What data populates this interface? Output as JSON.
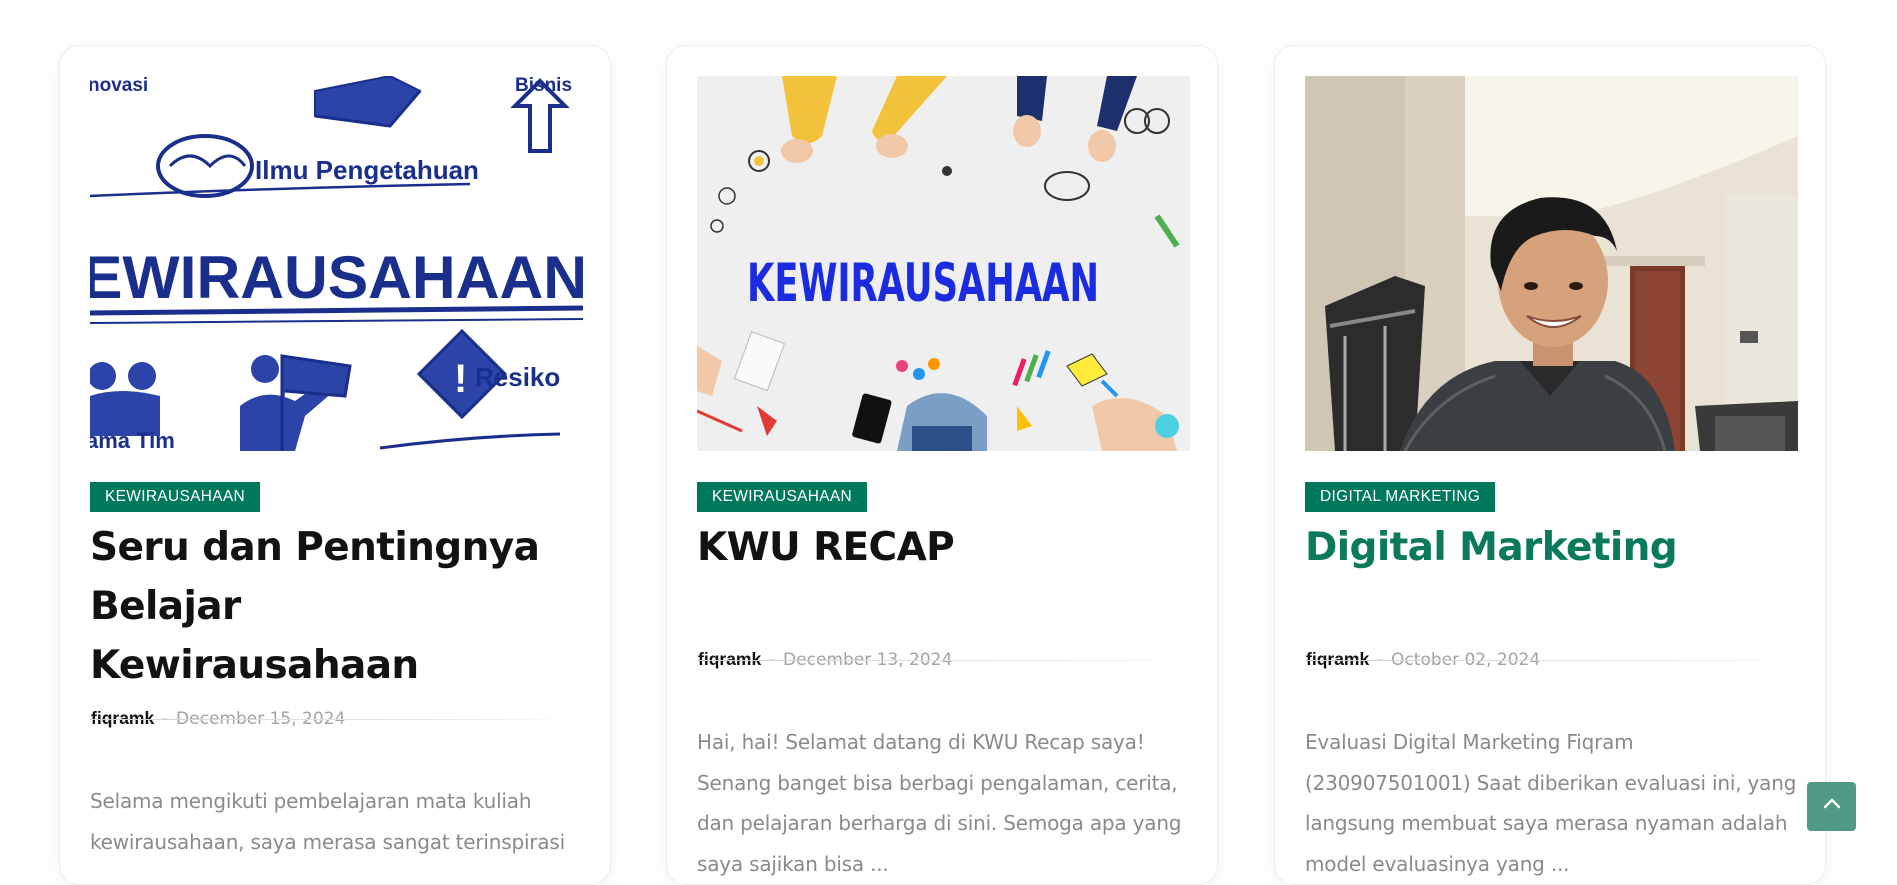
{
  "posts": [
    {
      "image_alt": "kewirausahaan illustration",
      "image_words": [
        "novasi",
        "Bisnis",
        "Ilmu Pengetahuan",
        "EWIRAUSAHAAN",
        "Resiko",
        "ama Tim"
      ],
      "category": "KEWIRAUSAHAAN",
      "title": "Seru dan Pentingnya Belajar Kewirausahaan",
      "author": "fiqramk",
      "separator": "-",
      "date": "December 15, 2024",
      "excerpt": "Selama mengikuti pembelajaran mata kuliah kewirausahaan, saya merasa sangat terinspirasi"
    },
    {
      "image_alt": "kewirausahaan hands illustration",
      "image_words": [
        "KEWIRAUSAHAAN"
      ],
      "category": "KEWIRAUSAHAAN",
      "title": "KWU RECAP",
      "author": "fiqramk",
      "separator": "-",
      "date": "December 13, 2024",
      "excerpt": "Hai, hai! Selamat datang di KWU Recap saya! Senang banget bisa berbagi pengalaman, cerita, dan pelajaran berharga di sini. Semoga apa yang saya sajikan bisa ..."
    },
    {
      "image_alt": "portrait photo",
      "image_words": [],
      "category": "DIGITAL MARKETING",
      "title": "Digital Marketing",
      "author": "fiqramk",
      "separator": "-",
      "date": "October 02, 2024",
      "excerpt": "Evaluasi Digital Marketing   Fiqram (230907501001) Saat diberikan evaluasi ini, yang langsung membuat saya merasa nyaman adalah model evaluasinya yang ..."
    }
  ],
  "back_to_top": {
    "icon": "chevron-up-icon"
  },
  "colors": {
    "accent": "#00785a",
    "title_active": "#0b7a5c",
    "back_to_top": "#4f9b85"
  }
}
